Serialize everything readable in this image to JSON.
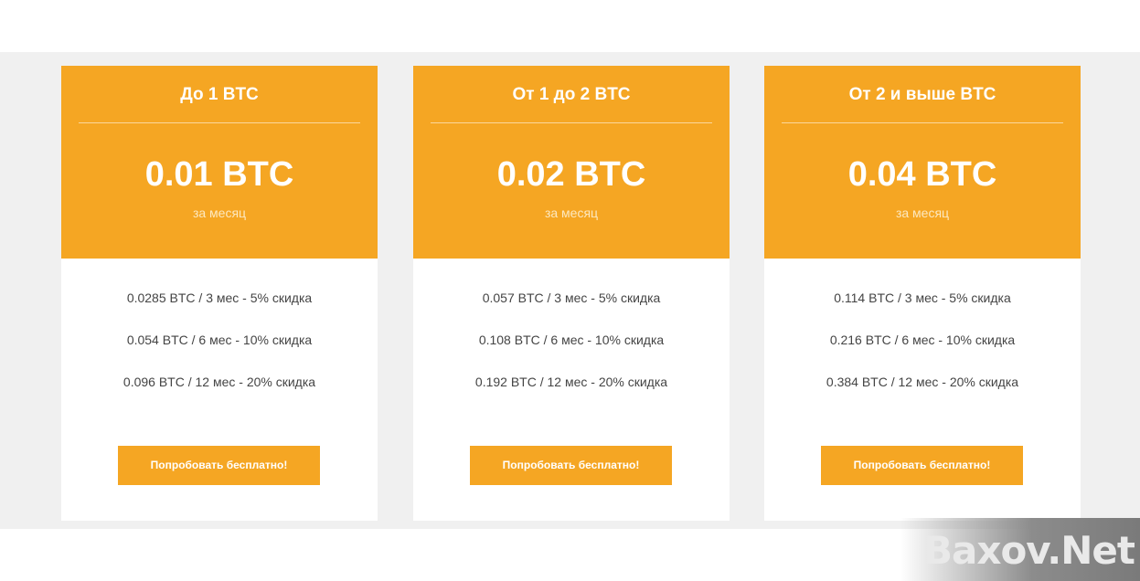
{
  "plans": [
    {
      "title": "До 1 BTC",
      "price": "0.01 BTC",
      "period": "за месяц",
      "offers": [
        "0.0285 BTC / 3 мес - 5% скидка",
        "0.054 BTC / 6 мес - 10% скидка",
        "0.096 BTC / 12 мес - 20% скидка"
      ],
      "button": "Попробовать бесплатно!"
    },
    {
      "title": "От 1 до 2 BTC",
      "price": "0.02 BTC",
      "period": "за месяц",
      "offers": [
        "0.057 BTC / 3 мес - 5% скидка",
        "0.108 BTC / 6 мес - 10% скидка",
        "0.192 BTC / 12 мес - 20% скидка"
      ],
      "button": "Попробовать бесплатно!"
    },
    {
      "title": "От 2 и выше BTC",
      "price": "0.04 BTC",
      "period": "за месяц",
      "offers": [
        "0.114 BTC / 3 мес - 5% скидка",
        "0.216 BTC / 6 мес - 10% скидка",
        "0.384 BTC / 12 мес - 20% скидка"
      ],
      "button": "Попробовать бесплатно!"
    }
  ],
  "watermark": "Baxov.Net",
  "colors": {
    "accent": "#f5a623",
    "section_bg": "#f0f0f0",
    "text": "#444444"
  }
}
